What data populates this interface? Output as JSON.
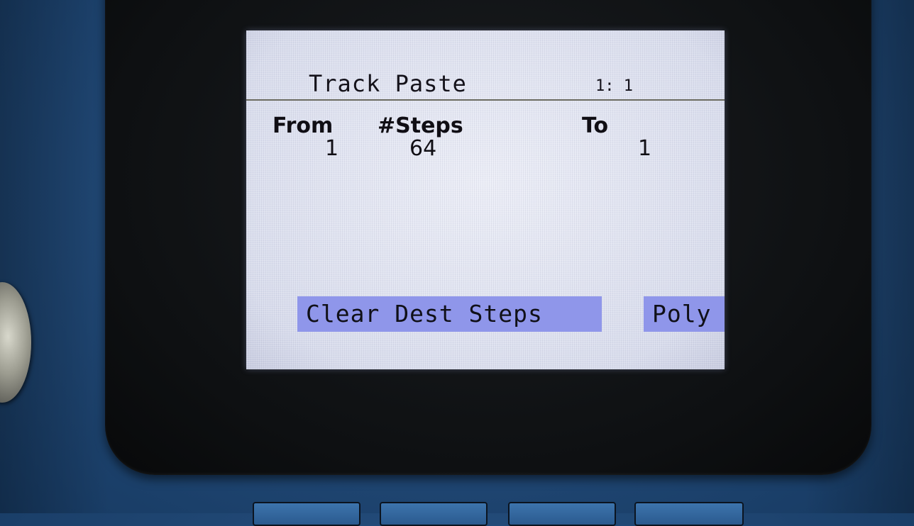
{
  "screen": {
    "title": "Track Paste",
    "position": "1: 1"
  },
  "columns": [
    {
      "label": "From",
      "value": "1"
    },
    {
      "label": "#Steps",
      "value": "64"
    },
    {
      "label": "To",
      "value": "1"
    }
  ],
  "softkeys": {
    "clear_dest_steps": "Clear Dest Steps",
    "poly": "Poly"
  },
  "colors": {
    "screen_background": "#dde1ef",
    "softkey_highlight": "#8f96ea",
    "text": "#14121a",
    "device_body": "#224a78",
    "bezel": "#0e1012"
  }
}
